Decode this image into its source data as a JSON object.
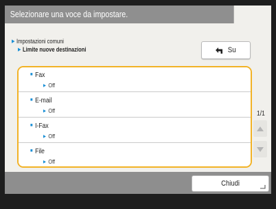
{
  "header": {
    "title": "Selezionare una voce da impostare."
  },
  "breadcrumb": {
    "level1": "Impostazioni comuni",
    "level2": "Limite nuove destinazioni"
  },
  "toolbar": {
    "up_label": "Su"
  },
  "list": {
    "items": [
      {
        "label": "Fax",
        "value": "Off"
      },
      {
        "label": "E-mail",
        "value": "Off"
      },
      {
        "label": "I-Fax",
        "value": "Off"
      },
      {
        "label": "File",
        "value": "Off"
      }
    ]
  },
  "pager": {
    "page_text": "1/1"
  },
  "footer": {
    "close_label": "Chiudi"
  },
  "colors": {
    "accent_border": "#f2b225",
    "bullet_blue": "#1a8fd6",
    "title_bar": "#8f8f8f",
    "panel_bg": "#f1f0ec"
  }
}
